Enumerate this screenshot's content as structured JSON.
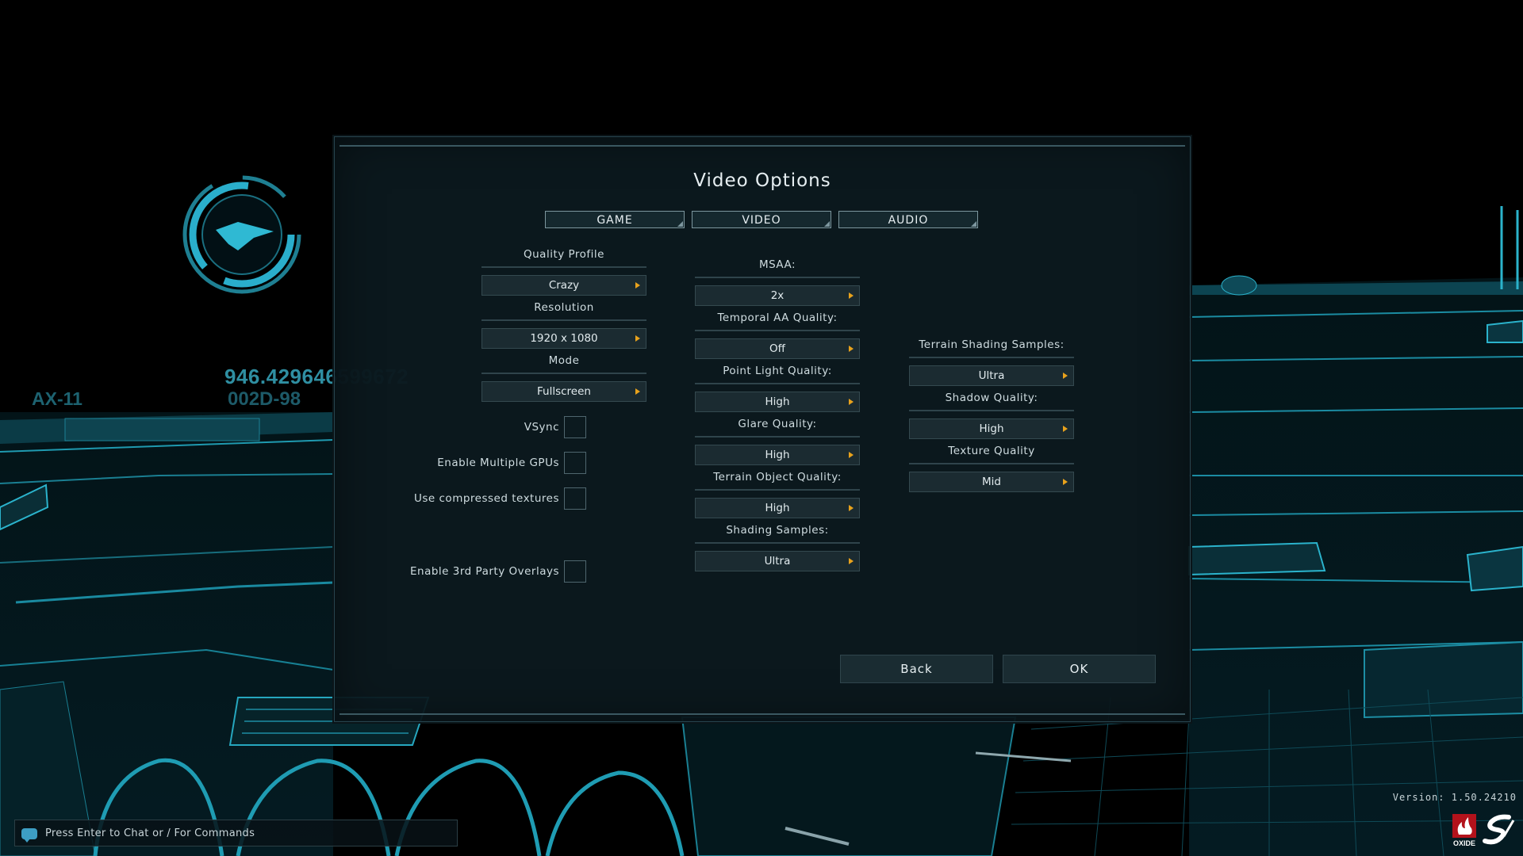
{
  "dialog": {
    "title": "Video Options",
    "tabs": [
      {
        "label": "GAME"
      },
      {
        "label": "VIDEO"
      },
      {
        "label": "AUDIO"
      }
    ],
    "column1": {
      "quality_profile": {
        "label": "Quality Profile",
        "value": "Crazy"
      },
      "resolution": {
        "label": "Resolution",
        "value": "1920 x 1080"
      },
      "mode": {
        "label": "Mode",
        "value": "Fullscreen"
      },
      "checkboxes": [
        {
          "label": "VSync",
          "checked": false
        },
        {
          "label": "Enable Multiple GPUs",
          "checked": false
        },
        {
          "label": "Use compressed textures",
          "checked": false
        },
        {
          "label": "Enable 3rd Party Overlays",
          "checked": false
        }
      ]
    },
    "column2": {
      "msaa": {
        "label": "MSAA:",
        "value": "2x"
      },
      "temporal_aa": {
        "label": "Temporal AA Quality:",
        "value": "Off"
      },
      "point_light": {
        "label": "Point Light Quality:",
        "value": "High"
      },
      "glare": {
        "label": "Glare Quality:",
        "value": "High"
      },
      "terrain_object": {
        "label": "Terrain Object Quality:",
        "value": "High"
      },
      "shading_samples": {
        "label": "Shading Samples:",
        "value": "Ultra"
      }
    },
    "column3": {
      "terrain_shading": {
        "label": "Terrain Shading Samples:",
        "value": "Ultra"
      },
      "shadow": {
        "label": "Shadow Quality:",
        "value": "High"
      },
      "texture": {
        "label": "Texture Quality",
        "value": "Mid"
      }
    },
    "buttons": {
      "back": "Back",
      "ok": "OK"
    }
  },
  "hud": {
    "number": "946.429646",
    "number_faded": "599672",
    "code": "002D-98",
    "unit": "AX-11"
  },
  "chat": {
    "placeholder": "Press Enter to Chat or / For Commands"
  },
  "version": "Version: 1.50.24210",
  "logos": {
    "left": "OXIDE",
    "right": "stardock-icon"
  },
  "colors": {
    "accent_cyan": "#2fb9d3",
    "dropdown_arrow": "#e8a21c",
    "dialog_bg": "#0c1a1f"
  }
}
